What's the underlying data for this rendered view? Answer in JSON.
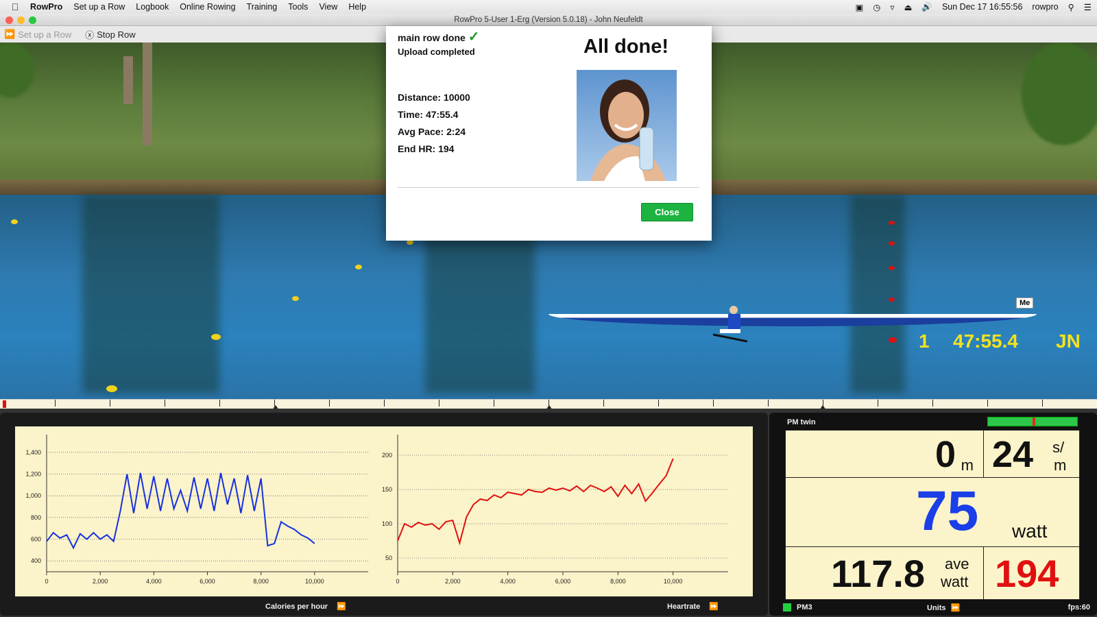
{
  "menubar": {
    "app": "RowPro",
    "items": [
      "Set up a Row",
      "Logbook",
      "Online Rowing",
      "Training",
      "Tools",
      "View",
      "Help"
    ],
    "clock": "Sun Dec 17  16:55:56",
    "user": "rowpro"
  },
  "window": {
    "title": "RowPro 5-User 1-Erg (Version 5.0.18) - John Neufeldt"
  },
  "toolbar": {
    "setup_label": "Set up a Row",
    "stop_label": "Stop Row"
  },
  "scene": {
    "boat_tag": "Me",
    "position": "1",
    "time": "47:55.4",
    "initials": "JN"
  },
  "dialog": {
    "header": "main row done",
    "status": "Upload completed",
    "title": "All done!",
    "stats": [
      "Distance: 10000",
      "Time: 47:55.4",
      "Avg Pace: 2:24",
      "End HR: 194"
    ],
    "close_label": "Close"
  },
  "charts_footer": {
    "left_label": "Calories per hour",
    "right_label": "Heartrate"
  },
  "pm": {
    "title": "PM twin",
    "distance": "0",
    "distance_unit": "m",
    "rate": "24",
    "rate_unit_top": "s/",
    "rate_unit_bottom": "m",
    "watts": "75",
    "watts_unit": "watt",
    "ave_watts": "117.8",
    "ave_unit_top": "ave",
    "ave_unit_bottom": "watt",
    "hr": "194",
    "monitor": "PM3",
    "units_label": "Units",
    "fps": "fps:60",
    "colors": {
      "watts": "#1a3ee8",
      "hr": "#e01010"
    }
  },
  "chart_data": [
    {
      "type": "line",
      "title": "Calories per hour",
      "xlabel": "",
      "ylabel": "",
      "xlim": [
        0,
        12000
      ],
      "ylim": [
        300,
        1500
      ],
      "x_ticks": [
        "0",
        "2,000",
        "4,000",
        "6,000",
        "8,000",
        "10,000"
      ],
      "x_tick_values": [
        0,
        2000,
        4000,
        6000,
        8000,
        10000
      ],
      "y_ticks": [
        "400",
        "600",
        "800",
        "1,000",
        "1,200",
        "1,400"
      ],
      "y_tick_values": [
        400,
        600,
        800,
        1000,
        1200,
        1400
      ],
      "grid": true,
      "series": [
        {
          "name": "Calories per hour",
          "color": "#1630e0",
          "x": [
            0,
            200,
            400,
            600,
            800,
            1000,
            1200,
            1400,
            1600,
            1800,
            2000,
            2200,
            2400,
            2600,
            2800,
            3000,
            3200,
            3400,
            3600,
            3800,
            4000,
            4200,
            4400,
            4600,
            4800,
            5000,
            5200,
            5400,
            5600,
            5800,
            6000,
            6200,
            6400,
            6600,
            6800,
            7000,
            7200,
            7400,
            7600,
            7800,
            8000,
            8200,
            8400,
            8600,
            8800,
            9000,
            9200,
            9400,
            9600,
            9800,
            10000
          ],
          "y": [
            580,
            660,
            610,
            640,
            520,
            650,
            600,
            660,
            600,
            640,
            580,
            860,
            1200,
            840,
            1210,
            880,
            1180,
            860,
            1160,
            880,
            1050,
            860,
            1170,
            880,
            1160,
            860,
            1210,
            920,
            1160,
            840,
            1190,
            860,
            1160,
            540,
            560,
            760,
            720,
            690,
            640,
            610,
            560
          ]
        }
      ]
    },
    {
      "type": "line",
      "title": "Heartrate",
      "xlabel": "",
      "ylabel": "",
      "xlim": [
        0,
        12000
      ],
      "ylim": [
        30,
        220
      ],
      "x_ticks": [
        "0",
        "2,000",
        "4,000",
        "6,000",
        "8,000",
        "10,000"
      ],
      "x_tick_values": [
        0,
        2000,
        4000,
        6000,
        8000,
        10000
      ],
      "y_ticks": [
        "50",
        "100",
        "150",
        "200"
      ],
      "y_tick_values": [
        50,
        100,
        150,
        200
      ],
      "grid": true,
      "series": [
        {
          "name": "Heartrate",
          "color": "#e01010",
          "x": [
            0,
            250,
            500,
            750,
            1000,
            1250,
            1500,
            1750,
            2000,
            2250,
            2500,
            2750,
            3000,
            3250,
            3500,
            3750,
            4000,
            4250,
            4500,
            4750,
            5000,
            5250,
            5500,
            5750,
            6000,
            6250,
            6500,
            6750,
            7000,
            7250,
            7500,
            7750,
            8000,
            8250,
            8500,
            8750,
            9000,
            9250,
            9500,
            9750,
            10000
          ],
          "y": [
            75,
            100,
            95,
            102,
            98,
            100,
            92,
            103,
            105,
            72,
            110,
            128,
            136,
            134,
            142,
            138,
            146,
            144,
            142,
            150,
            147,
            146,
            152,
            149,
            152,
            148,
            155,
            147,
            156,
            152,
            147,
            154,
            140,
            156,
            144,
            158,
            133,
            145,
            158,
            170,
            195
          ]
        }
      ]
    }
  ]
}
